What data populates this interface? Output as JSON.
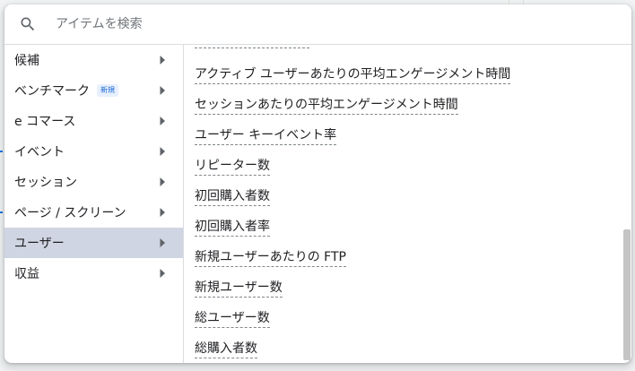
{
  "search": {
    "placeholder": "アイテムを検索",
    "value": ""
  },
  "categories": [
    {
      "label": "候補",
      "selected": false
    },
    {
      "label": "ベンチマーク",
      "badge": "新規",
      "selected": false
    },
    {
      "label": "e コマース",
      "selected": false
    },
    {
      "label": "イベント",
      "selected": false
    },
    {
      "label": "セッション",
      "selected": false
    },
    {
      "label": "ページ / スクリーン",
      "selected": false
    },
    {
      "label": "ユーザー",
      "selected": true
    },
    {
      "label": "収益",
      "selected": false
    }
  ],
  "metrics": [
    {
      "label": "アクティブ ユーザーあたりの平均エンゲージメント時間"
    },
    {
      "label": "セッションあたりの平均エンゲージメント時間"
    },
    {
      "label": "ユーザー キーイベント率"
    },
    {
      "label": "リピーター数"
    },
    {
      "label": "初回購入者数"
    },
    {
      "label": "初回購入者率"
    },
    {
      "label": "新規ユーザーあたりの FTP"
    },
    {
      "label": "新規ユーザー数"
    },
    {
      "label": "総ユーザー数"
    },
    {
      "label": "総購入者数"
    }
  ],
  "colors": {
    "selected_bg": "#cfd5e2",
    "badge": "#1967d2",
    "accent": "#1a73e8"
  },
  "icons": {
    "search": "search-icon",
    "chevron": "chevron-right-icon"
  }
}
